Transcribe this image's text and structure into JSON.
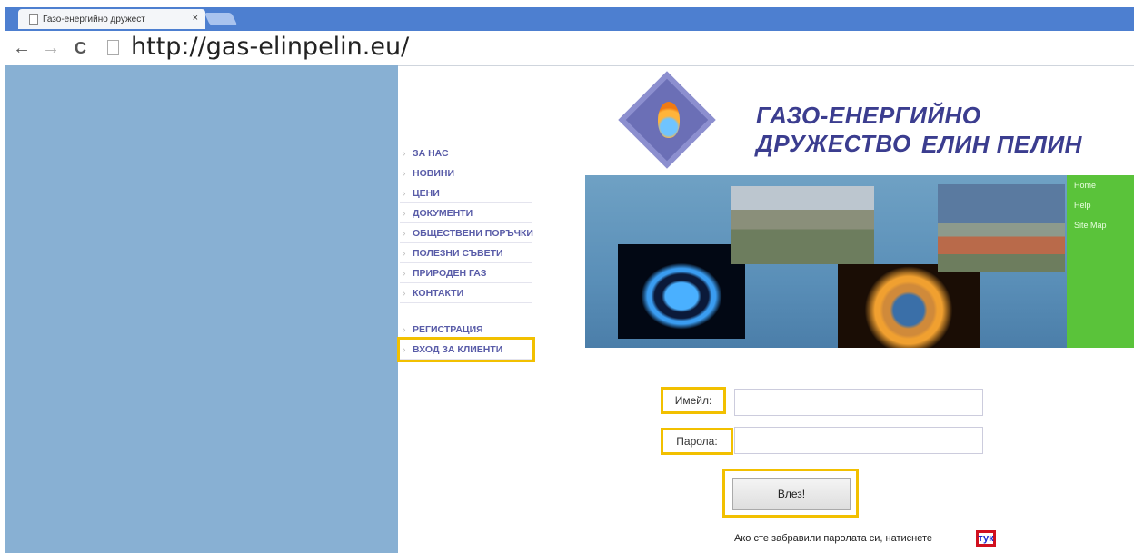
{
  "browser": {
    "tab_title": "Газо-енергийно дружест",
    "tab_close": "×",
    "back": "←",
    "forward": "→",
    "reload": "C",
    "url": "http://gas-elinpelin.eu/"
  },
  "header": {
    "title_line1": "ГАЗО-ЕНЕРГИЙНО ДРУЖЕСТВО",
    "title_line2": "ЕЛИН ПЕЛИН"
  },
  "menu": {
    "items": [
      "ЗА НАС",
      "НОВИНИ",
      "ЦЕНИ",
      "ДОКУМЕНТИ",
      "ОБЩЕСТВЕНИ ПОРЪЧКИ",
      "ПОЛЕЗНИ СЪВЕТИ",
      "ПРИРОДЕН ГАЗ",
      "КОНТАКТИ"
    ],
    "register": "РЕГИСТРАЦИЯ",
    "login": "ВХОД ЗА КЛИЕНТИ"
  },
  "sidebar_links": [
    "Home",
    "Help",
    "Site Map"
  ],
  "form": {
    "email_label": "Имейл:",
    "email_value": "",
    "password_label": "Парола:",
    "password_value": "",
    "submit": "Влез!",
    "forgot_text": "Ако сте забравили паролата си, натиснете",
    "forgot_link": "тук"
  },
  "colors": {
    "left_panel": "#88b0d3",
    "brand_blue": "#3b3d8f",
    "menu_text": "#595ca8",
    "highlight_yellow": "#f2c000",
    "highlight_red": "#d1101f",
    "right_bar_green": "#5ac33a"
  }
}
